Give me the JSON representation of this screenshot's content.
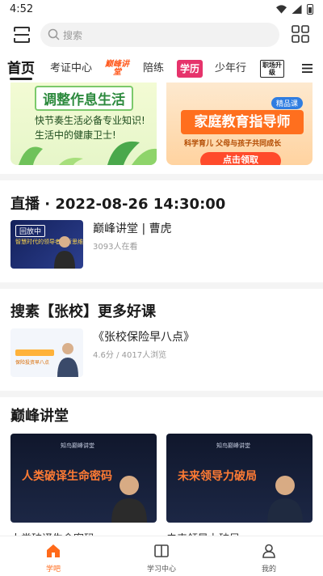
{
  "status_bar": {
    "time": "4:52",
    "icons": [
      "wifi-icon",
      "signal-icon",
      "battery-icon"
    ]
  },
  "search": {
    "placeholder": "搜索"
  },
  "tabs": [
    {
      "label": "首页",
      "active": true
    },
    {
      "label": "考证中心",
      "active": false
    },
    {
      "label": "巅峰讲堂",
      "logo": true,
      "color": "#ff5a1f"
    },
    {
      "label": "陪练",
      "active": false
    },
    {
      "label": "学历",
      "logo": true,
      "color": "#e6336b"
    },
    {
      "label": "少年行",
      "active": false
    },
    {
      "label": "职场升级",
      "logo": true,
      "color": "#222222"
    }
  ],
  "banners": {
    "left": {
      "title": "调整作息生活",
      "line1": "快节奏生活必备专业知识!",
      "line2": "生活中的健康卫士!"
    },
    "right": {
      "title": "家庭教育指导师",
      "badge": "精品课",
      "subtitle": "科学育儿 父母与孩子共同成长",
      "cta": "点击领取"
    }
  },
  "live": {
    "heading": "直播 · 2022-08-26 14:30:00",
    "thumb_tag": "回放中",
    "thumb_caption": "智慧时代的领导者与新思维",
    "title": "巅峰讲堂 | 曹虎",
    "viewers": "3093人在看"
  },
  "search_results": {
    "heading": "搜素【张校】更多好课",
    "thumb_caption": "保险投资早八点",
    "title": "《张校保险早八点》",
    "meta": "4.6分 / 4017人浏览"
  },
  "peak_lecture": {
    "heading": "巅峰讲堂",
    "courses": [
      {
        "org": "知鸟巅峰讲堂",
        "title": "人类破译生命密码",
        "below": "人类破译生命密码"
      },
      {
        "org": "知鸟巅峰讲堂",
        "title": "未来领导力破局",
        "below": "未来领导力破局"
      }
    ]
  },
  "bottom_nav": [
    {
      "label": "学吧",
      "icon": "home-icon",
      "active": true
    },
    {
      "label": "学习中心",
      "icon": "book-icon",
      "active": false
    },
    {
      "label": "我的",
      "icon": "user-icon",
      "active": false
    }
  ],
  "colors": {
    "accent": "#ff6a1a",
    "brand_orange": "#ff5a1f"
  }
}
